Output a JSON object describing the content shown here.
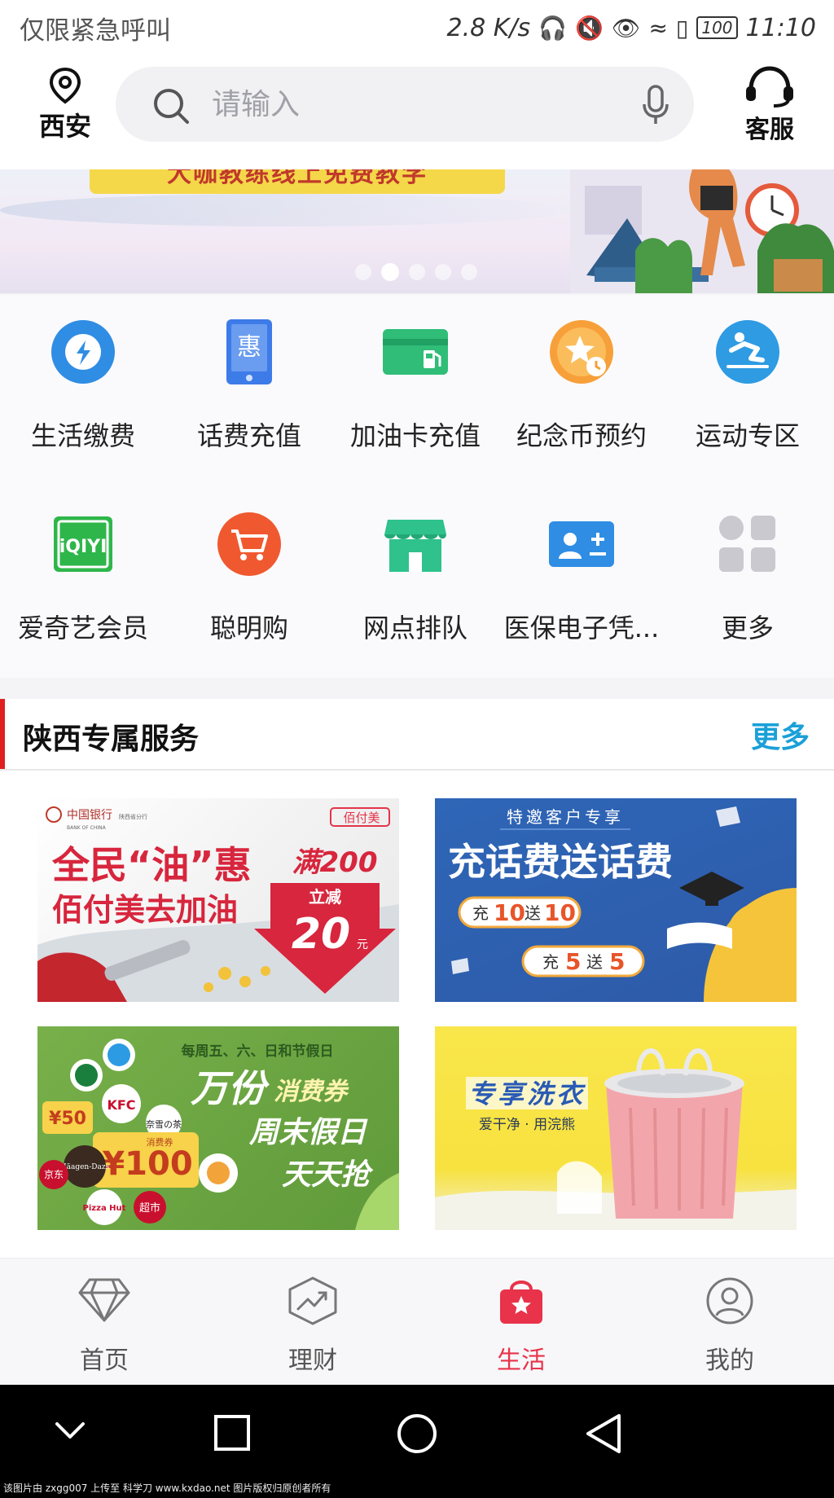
{
  "status_bar": {
    "left_text": "仅限紧急呼叫",
    "speed": "2.8 K/s",
    "battery": "100",
    "time": "11:10"
  },
  "header": {
    "location": "西安",
    "search_placeholder": "请输入",
    "customer_service": "客服"
  },
  "banner": {
    "headline": "大咖教练线上免费教学",
    "dots": 5,
    "active_dot": 2
  },
  "quick_services": [
    {
      "label": "生活缴费",
      "icon": "bolt-icon"
    },
    {
      "label": "话费充值",
      "icon": "phone-discount-icon"
    },
    {
      "label": "加油卡充值",
      "icon": "fuel-card-icon"
    },
    {
      "label": "纪念币预约",
      "icon": "coin-star-icon"
    },
    {
      "label": "运动专区",
      "icon": "sport-icon"
    },
    {
      "label": "爱奇艺会员",
      "icon": "iqiyi-icon"
    },
    {
      "label": "聪明购",
      "icon": "cart-icon"
    },
    {
      "label": "网点排队",
      "icon": "branch-icon"
    },
    {
      "label": "医保电子凭...",
      "icon": "medical-card-icon"
    },
    {
      "label": "更多",
      "icon": "more-grid-icon"
    }
  ],
  "exclusive": {
    "title": "陕西专属服务",
    "more": "更多",
    "cards": [
      {
        "bank": "中国银行",
        "bank_en": "BANK OF CHINA",
        "branch": "陕西省分行",
        "brand": "佰付美",
        "line1": "全民“油”惠",
        "line2": "佰付美去加油",
        "promo_top": "满200",
        "promo_mid": "立减",
        "promo_num": "20",
        "promo_unit": "元"
      },
      {
        "tag": "特邀客户专享",
        "title": "充话费送话费",
        "offer1_a": "充",
        "offer1_b": "10",
        "offer1_c": "送",
        "offer1_d": "10",
        "offer2_a": "充",
        "offer2_b": "5",
        "offer2_c": "送",
        "offer2_d": "5"
      },
      {
        "note": "每周五、六、日和节假日",
        "big": "万份",
        "big2": "消费券",
        "line2": "周末假日",
        "line3": "天天抢",
        "coupon_small": "¥50",
        "coupon_big": "¥100",
        "brands": [
          "KFC",
          "Häagen-Dazs",
          "Pizza Hut",
          "京东",
          "超市",
          "奈雪の茶"
        ],
        "coupon_label": "消费券"
      },
      {
        "title": "专享洗衣",
        "subtitle": "爱干净 · 用浣熊"
      }
    ]
  },
  "tabbar": [
    {
      "label": "首页",
      "icon": "diamond-icon"
    },
    {
      "label": "理财",
      "icon": "chart-trend-icon"
    },
    {
      "label": "生活",
      "icon": "shopping-bag-icon",
      "active": true
    },
    {
      "label": "我的",
      "icon": "user-icon"
    }
  ],
  "watermark": "该图片由 zxgg007 上传至 科学刀 www.kxdao.net 图片版权归原创者所有",
  "colors": {
    "accent_red": "#e8334a",
    "link_blue": "#1aa0d8",
    "section_bar": "#e02020"
  }
}
